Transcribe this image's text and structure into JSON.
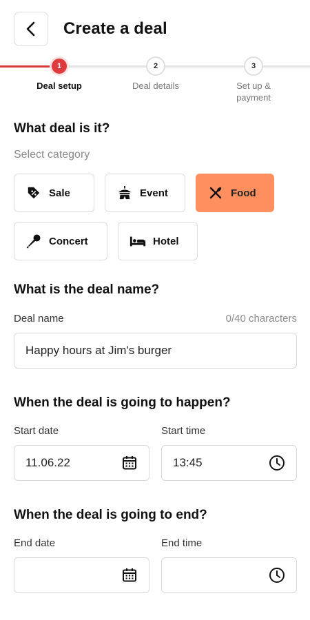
{
  "header": {
    "title": "Create a deal"
  },
  "stepper": {
    "steps": [
      {
        "number": "1",
        "label": "Deal setup"
      },
      {
        "number": "2",
        "label": "Deal details"
      },
      {
        "number": "3",
        "label": "Set up & payment"
      }
    ]
  },
  "category": {
    "title": "What deal is it?",
    "subtitle": "Select category",
    "chips": [
      {
        "label": "Sale",
        "icon": "tag-percent-icon"
      },
      {
        "label": "Event",
        "icon": "circus-tent-icon"
      },
      {
        "label": "Food",
        "icon": "utensils-icon",
        "selected": true
      },
      {
        "label": "Concert",
        "icon": "microphone-icon"
      },
      {
        "label": "Hotel",
        "icon": "bed-icon"
      }
    ],
    "selected_color": "#ff8f5e"
  },
  "deal_name": {
    "title": "What is the deal name?",
    "field_label": "Deal name",
    "counter": "0/40 characters",
    "value": "Happy hours at Jim's burger"
  },
  "start": {
    "title": "When the deal is going to happen?",
    "date_label": "Start date",
    "time_label": "Start time",
    "date_value": "11.06.22",
    "time_value": "13:45"
  },
  "end": {
    "title": "When the deal is going to end?",
    "date_label": "End date",
    "time_label": "End time",
    "date_value": "",
    "time_value": ""
  },
  "colors": {
    "accent_red": "#df3b3e",
    "border": "#dcdcdc"
  }
}
